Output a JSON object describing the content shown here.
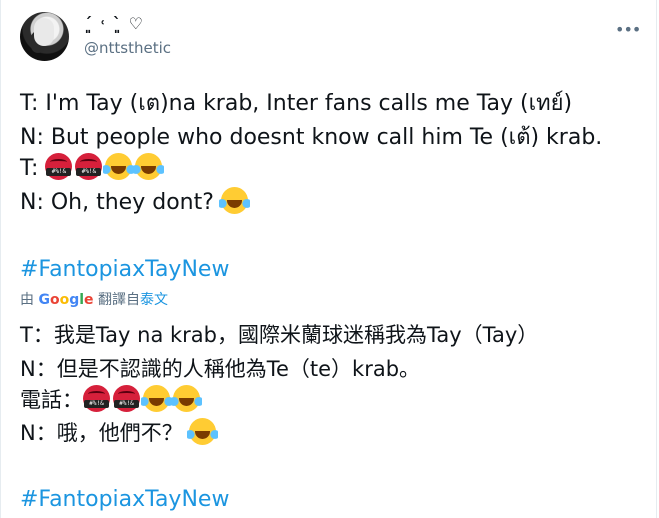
{
  "tweet": {
    "display_name": "ˊ͈ ˓ ˋ͈ ♡",
    "handle": "@nttsthetic",
    "more_label": "•••",
    "lines": [
      "T: I'm Tay (เต)na krab, Inter fans calls me Tay (เทย์)",
      "N: But people who doesnt know call him Te (เต้) krab.",
      "T:",
      "N: Oh, they dont?",
      "#FantopiaxTayNew"
    ]
  },
  "translation": {
    "prefix": "由",
    "provider": "Google",
    "action": "翻譯自",
    "source_lang": "泰文",
    "lines": [
      "T：我是Tay na krab，國際米蘭球迷稱我為Tay（Tay）",
      " N：但是不認識的人稱他為Te（te）krab。",
      "電話：",
      " N：哦，他們不？",
      "#FantopiaxTayNew"
    ]
  },
  "emoji": {
    "angry_text": "#%!&"
  }
}
